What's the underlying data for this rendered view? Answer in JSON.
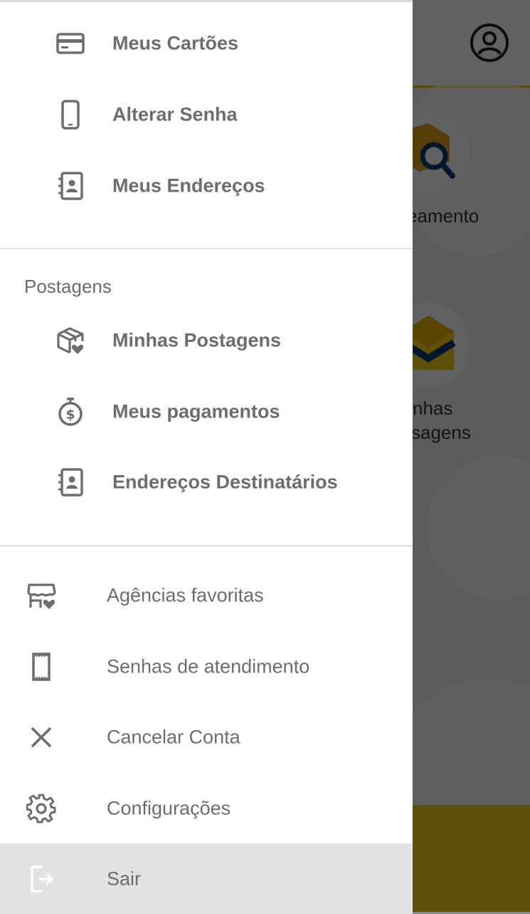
{
  "background": {
    "tiles": [
      {
        "label": "eamento"
      },
      {
        "label_line1": "nhas",
        "label_line2": "sagens"
      }
    ],
    "icons": {
      "profile": "account-circle-icon",
      "tracking": "package-search-icon",
      "messages": "envelope-icon"
    }
  },
  "drawer": {
    "account_items": [
      {
        "label": "Meus Cartões",
        "icon": "credit-card-icon"
      },
      {
        "label": "Alterar Senha",
        "icon": "smartphone-icon"
      },
      {
        "label": "Meus Endereços",
        "icon": "address-book-icon"
      }
    ],
    "postagens": {
      "title": "Postagens",
      "items": [
        {
          "label": "Minhas Postagens",
          "icon": "package-heart-icon"
        },
        {
          "label": "Meus pagamentos",
          "icon": "stopwatch-dollar-icon"
        },
        {
          "label": "Endereços Destinatários",
          "icon": "address-book-icon"
        }
      ]
    },
    "general_items": [
      {
        "label": "Agências favoritas",
        "icon": "store-heart-icon"
      },
      {
        "label": "Senhas de atendimento",
        "icon": "ticket-icon"
      },
      {
        "label": "Cancelar Conta",
        "icon": "close-icon"
      },
      {
        "label": "Configurações",
        "icon": "gear-icon"
      },
      {
        "label": "Sair",
        "icon": "logout-icon",
        "selected": true
      }
    ]
  },
  "colors": {
    "brand_yellow": "#f4d21f",
    "text_gray": "#6d6d6d",
    "selected_bg": "#e2e2e2"
  }
}
